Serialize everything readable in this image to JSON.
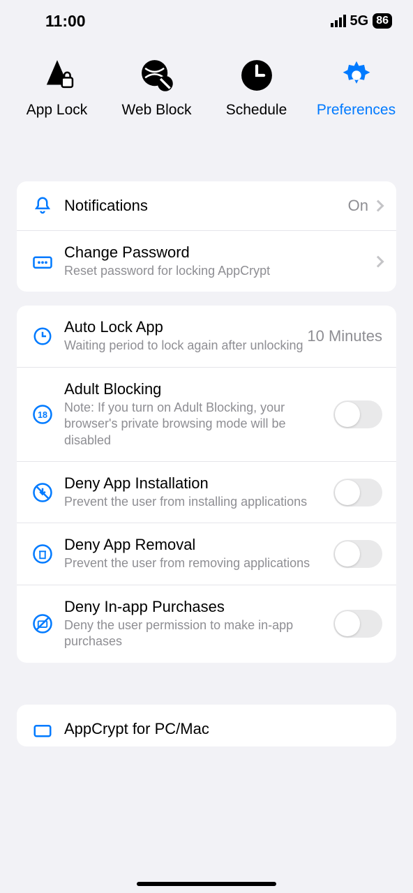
{
  "status": {
    "time": "11:00",
    "cellular": "5G",
    "battery": "86"
  },
  "tabs": {
    "applock": "App Lock",
    "webblock": "Web Block",
    "schedule": "Schedule",
    "preferences": "Preferences"
  },
  "section1": {
    "notifications": {
      "title": "Notifications",
      "value": "On"
    },
    "password": {
      "title": "Change Password",
      "sub": "Reset password for locking AppCrypt"
    }
  },
  "section2": {
    "autolock": {
      "title": "Auto Lock App",
      "sub": "Waiting period to lock again after unlocking",
      "value": "10 Minutes"
    },
    "adult": {
      "title": "Adult Blocking",
      "sub": "Note: If you turn on Adult Blocking, your browser's private browsing mode will be disabled"
    },
    "denyinstall": {
      "title": "Deny App Installation",
      "sub": "Prevent the user from installing applications"
    },
    "denyremove": {
      "title": "Deny App Removal",
      "sub": "Prevent the user from removing applications"
    },
    "denyiap": {
      "title": "Deny In-app Purchases",
      "sub": "Deny the user permission to make in-app purchases"
    }
  },
  "section3": {
    "pcmac": {
      "title": "AppCrypt for PC/Mac"
    }
  }
}
